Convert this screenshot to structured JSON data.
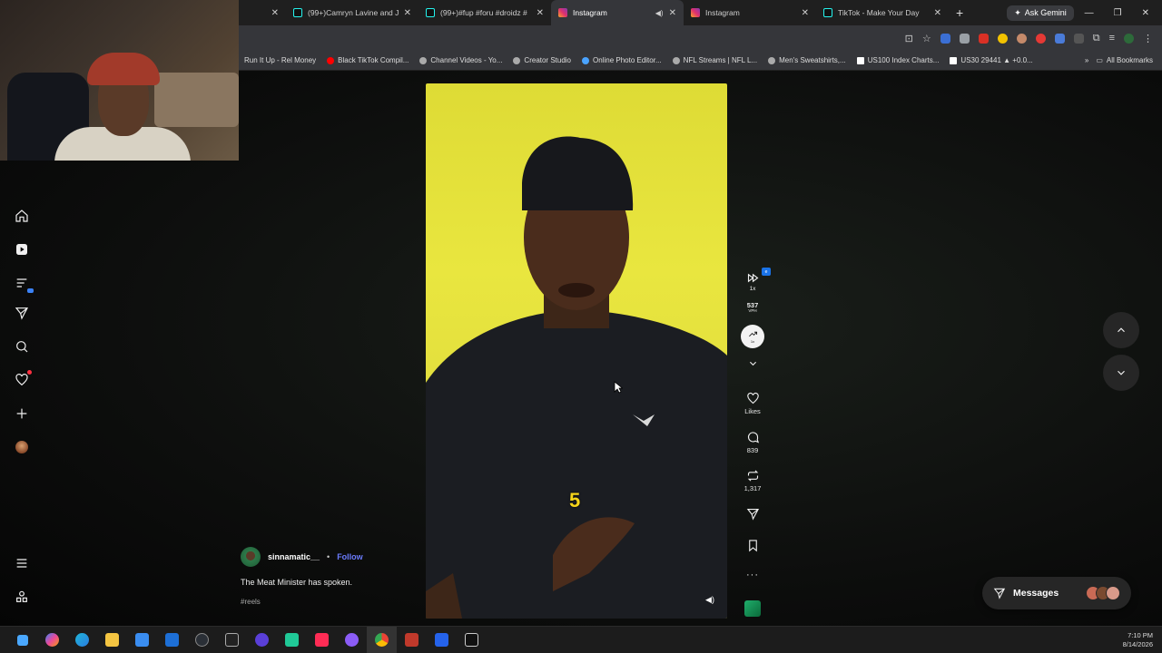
{
  "tabs": [
    {
      "title": "",
      "icon": "blank-favicon",
      "active": false
    },
    {
      "title": "(99+)Camryn Lavine and Ja",
      "icon": "tiktok-favicon",
      "active": false
    },
    {
      "title": "(99+)#fup #foru #droidz #",
      "icon": "tiktok-favicon",
      "active": false
    },
    {
      "title": "Instagram",
      "icon": "instagram-favicon",
      "active": true
    },
    {
      "title": "Instagram",
      "icon": "instagram-favicon",
      "active": false
    },
    {
      "title": "TikTok - Make Your Day",
      "icon": "tiktok-favicon",
      "active": false
    }
  ],
  "new_tab": "+",
  "ask_gemini": "Ask Gemini",
  "bookmarks": [
    "Run It Up - Rel Money",
    "Black TikTok Compil...",
    "Channel Videos - Yo...",
    "Creator Studio",
    "Online Photo Editor...",
    "NFL Streams | NFL L...",
    "Men's Sweatshirts,...",
    "US100 Index Charts...",
    "US30 29441 ▲ +0.0..."
  ],
  "bookmarks_more": "»",
  "all_bookmarks": "All Bookmarks",
  "video": {
    "overlay_number": "5",
    "volume_icon": "speaker-icon"
  },
  "actions": {
    "speed": "1x",
    "vph_value": "537",
    "vph_unit": "VPH",
    "trend_label": "1x",
    "likes_label": "Likes",
    "comments_count": "839",
    "reposts_count": "1,317",
    "more": "···"
  },
  "caption": {
    "username": "sinnamatic__",
    "separator": "•",
    "follow": "Follow",
    "text": "The Meat Minister has spoken.",
    "hashtag": "#reels"
  },
  "messages": {
    "label": "Messages"
  },
  "clock": {
    "time": "7:10 PM",
    "date": "8/14/2026"
  },
  "colors": {
    "video_bg": "#e3e03c",
    "follow_link": "#6b7cff",
    "notification_dot": "#ff3040"
  }
}
